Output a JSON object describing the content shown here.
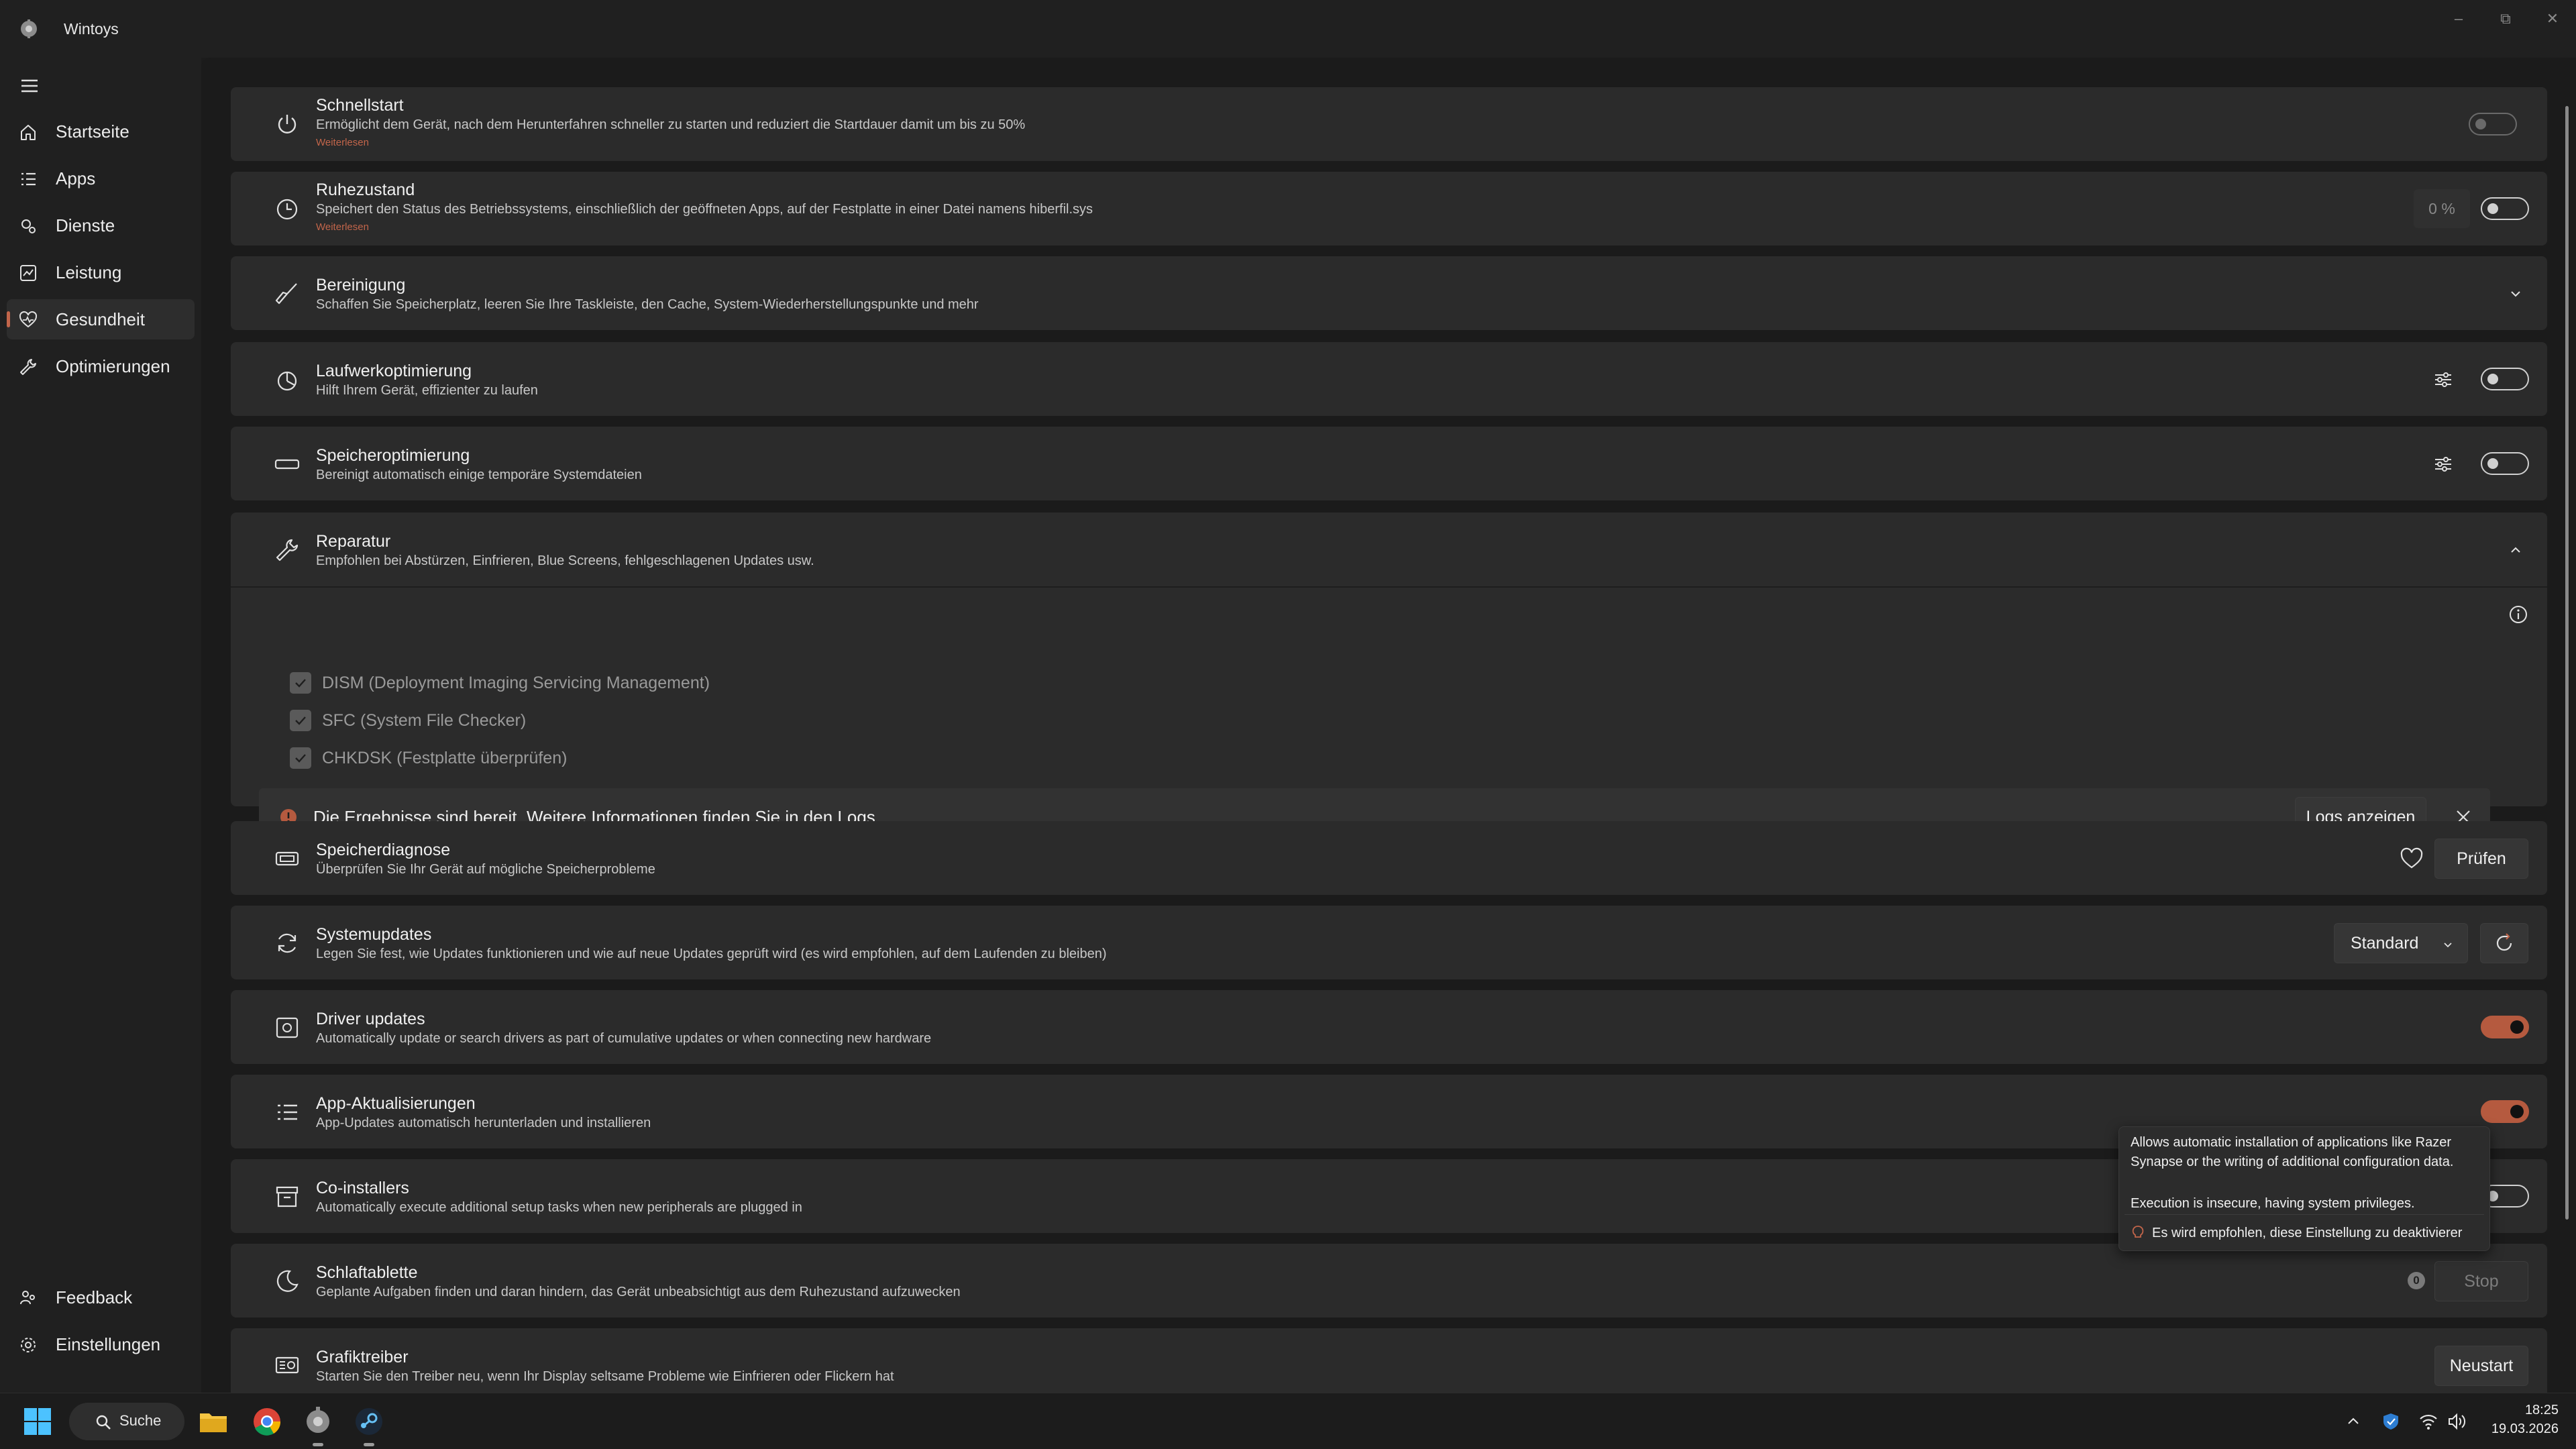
{
  "app": {
    "title": "Wintoys",
    "minimize_glyph": "–",
    "maximize_glyph": "⧉",
    "close_glyph": "✕"
  },
  "sidebar": {
    "items": [
      {
        "label": "Startseite",
        "icon": "home-icon"
      },
      {
        "label": "Apps",
        "icon": "apps-list-icon"
      },
      {
        "label": "Dienste",
        "icon": "gears-icon"
      },
      {
        "label": "Leistung",
        "icon": "performance-chart-icon"
      },
      {
        "label": "Gesundheit",
        "icon": "heart-pulse-icon",
        "active": true
      },
      {
        "label": "Optimierungen",
        "icon": "wrench-icon"
      }
    ],
    "footer": [
      {
        "label": "Feedback",
        "icon": "people-icon"
      },
      {
        "label": "Einstellungen",
        "icon": "gear-icon"
      }
    ]
  },
  "cards": {
    "schnellstart": {
      "title": "Schnellstart",
      "desc": "Ermöglicht dem Gerät, nach dem Herunterfahren schneller zu starten und reduziert die Startdauer damit um bis zu 50%",
      "link": "Weiterlesen",
      "toggle": "disabled-off"
    },
    "ruhezustand": {
      "title": "Ruhezustand",
      "desc": "Speichert den Status des Betriebssystems, einschließlich der geöffneten Apps, auf der Festplatte in einer Datei namens hiberfil.sys",
      "link": "Weiterlesen",
      "percent": "0 %",
      "toggle": "off"
    },
    "bereinigung": {
      "title": "Bereinigung",
      "desc": "Schaffen Sie Speicherplatz, leeren Sie Ihre Taskleiste, den Cache, System-Wiederherstellungspunkte und mehr",
      "expander": "collapsed"
    },
    "laufwerk": {
      "title": "Laufwerkoptimierung",
      "desc": "Hilft Ihrem Gerät, effizienter zu laufen",
      "toggle": "off"
    },
    "speicheropt": {
      "title": "Speicheroptimierung",
      "desc": "Bereinigt automatisch einige temporäre Systemdateien",
      "toggle": "off"
    },
    "reparatur": {
      "title": "Reparatur",
      "desc": "Empfohlen bei Abstürzen, Einfrieren, Blue Screens, fehlgeschlagenen Updates usw.",
      "expander": "expanded",
      "checks": [
        {
          "label": "DISM (Deployment Imaging Servicing Management)",
          "checked": true
        },
        {
          "label": "SFC (System File Checker)",
          "checked": true
        },
        {
          "label": "CHKDSK (Festplatte überprüfen)",
          "checked": true
        }
      ],
      "info_message": "Die Ergebnisse sind bereit. Weitere Informationen finden Sie in den Logs.",
      "logs_button": "Logs anzeigen"
    },
    "speicherdiagnose": {
      "title": "Speicherdiagnose",
      "desc": "Überprüfen Sie Ihr Gerät auf mögliche Speicherprobleme",
      "button": "Prüfen"
    },
    "systemupdates": {
      "title": "Systemupdates",
      "desc": "Legen Sie fest, wie Updates funktionieren und wie auf neue Updates geprüft wird (es wird empfohlen, auf dem Laufenden zu bleiben)",
      "dropdown": "Standard"
    },
    "driver": {
      "title": "Driver updates",
      "desc": "Automatically update or search drivers as part of cumulative updates or when connecting new hardware",
      "toggle": "on"
    },
    "appupdates": {
      "title": "App-Aktualisierungen",
      "desc": "App-Updates automatisch herunterladen und installieren",
      "toggle": "on"
    },
    "coinstallers": {
      "title": "Co-installers",
      "desc": "Automatically execute additional setup tasks when new peripherals are plugged in",
      "toggle": "off"
    },
    "schlaftablette": {
      "title": "Schlaftablette",
      "desc": "Geplante Aufgaben finden und daran hindern, das Gerät unbeabsichtigt aus dem Ruhezustand aufzuwecken",
      "badge": "0",
      "button": "Stop"
    },
    "grafik": {
      "title": "Grafiktreiber",
      "desc": "Starten Sie den Treiber neu, wenn Ihr Display seltsame Probleme wie Einfrieren oder Flickern hat",
      "button": "Neustart"
    }
  },
  "tooltip": {
    "line1": "Allows automatic installation of applications like Razer",
    "line2": "Synapse or the writing of additional configuration data.",
    "line3": "Execution is insecure, having system privileges.",
    "warning": "Es wird empfohlen, diese Einstellung zu deaktivierer"
  },
  "taskbar": {
    "search_label": "Suche",
    "apps": [
      "windows-start-icon",
      "file-explorer-icon",
      "chrome-icon",
      "wintoys-icon",
      "steam-icon"
    ],
    "time": "18:25",
    "date": "19.03.2026"
  },
  "colors": {
    "accent": "#c2654a",
    "toggle_on": "#b55a3f",
    "card_bg": "#2b2b2b",
    "background": "#1b1b1b"
  }
}
